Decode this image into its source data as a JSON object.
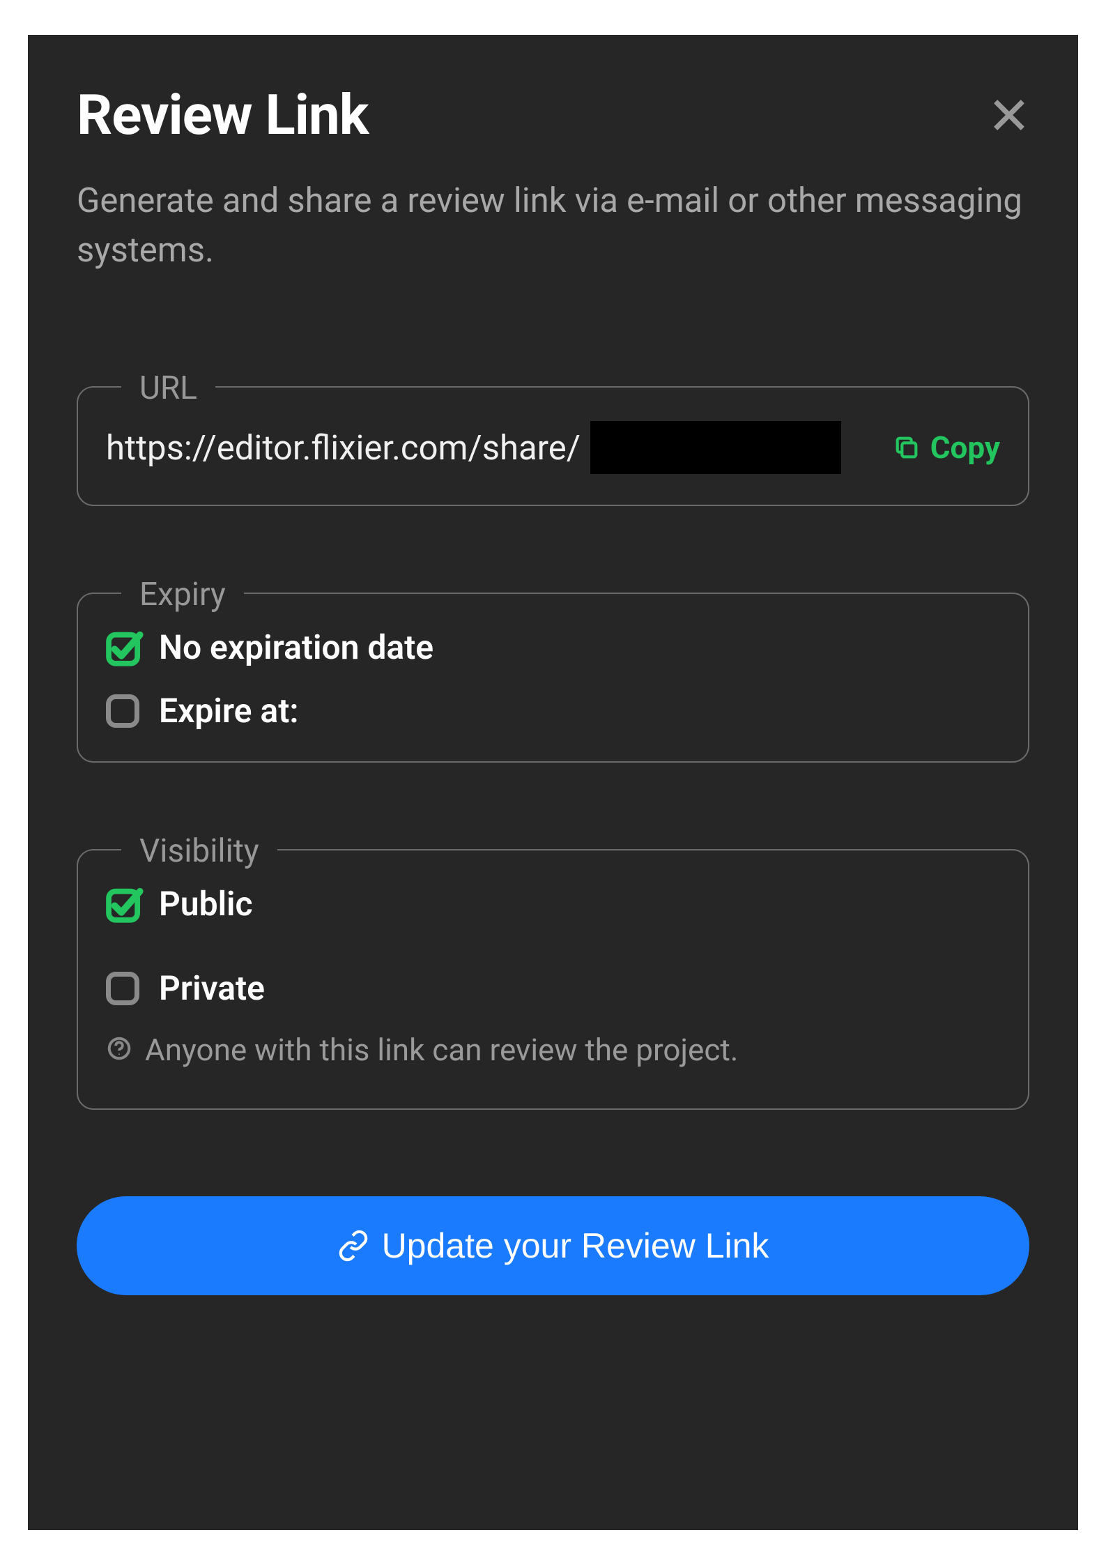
{
  "modal": {
    "title": "Review Link",
    "description": "Generate and share a review link via e-mail or other messaging systems."
  },
  "url_section": {
    "legend": "URL",
    "value": "https://editor.flixier.com/share/",
    "copy_label": "Copy"
  },
  "expiry_section": {
    "legend": "Expiry",
    "option_no_expiration": {
      "label": "No expiration date",
      "checked": true
    },
    "option_expire_at": {
      "label": "Expire at:",
      "checked": false
    }
  },
  "visibility_section": {
    "legend": "Visibility",
    "option_public": {
      "label": "Public",
      "checked": true
    },
    "option_private": {
      "label": "Private",
      "checked": false
    },
    "help_text": "Anyone with this link can review the project."
  },
  "actions": {
    "update_label": "Update your Review Link"
  },
  "colors": {
    "accent_green": "#22c55e",
    "accent_blue": "#1a7bff",
    "bg_modal": "#262626"
  }
}
